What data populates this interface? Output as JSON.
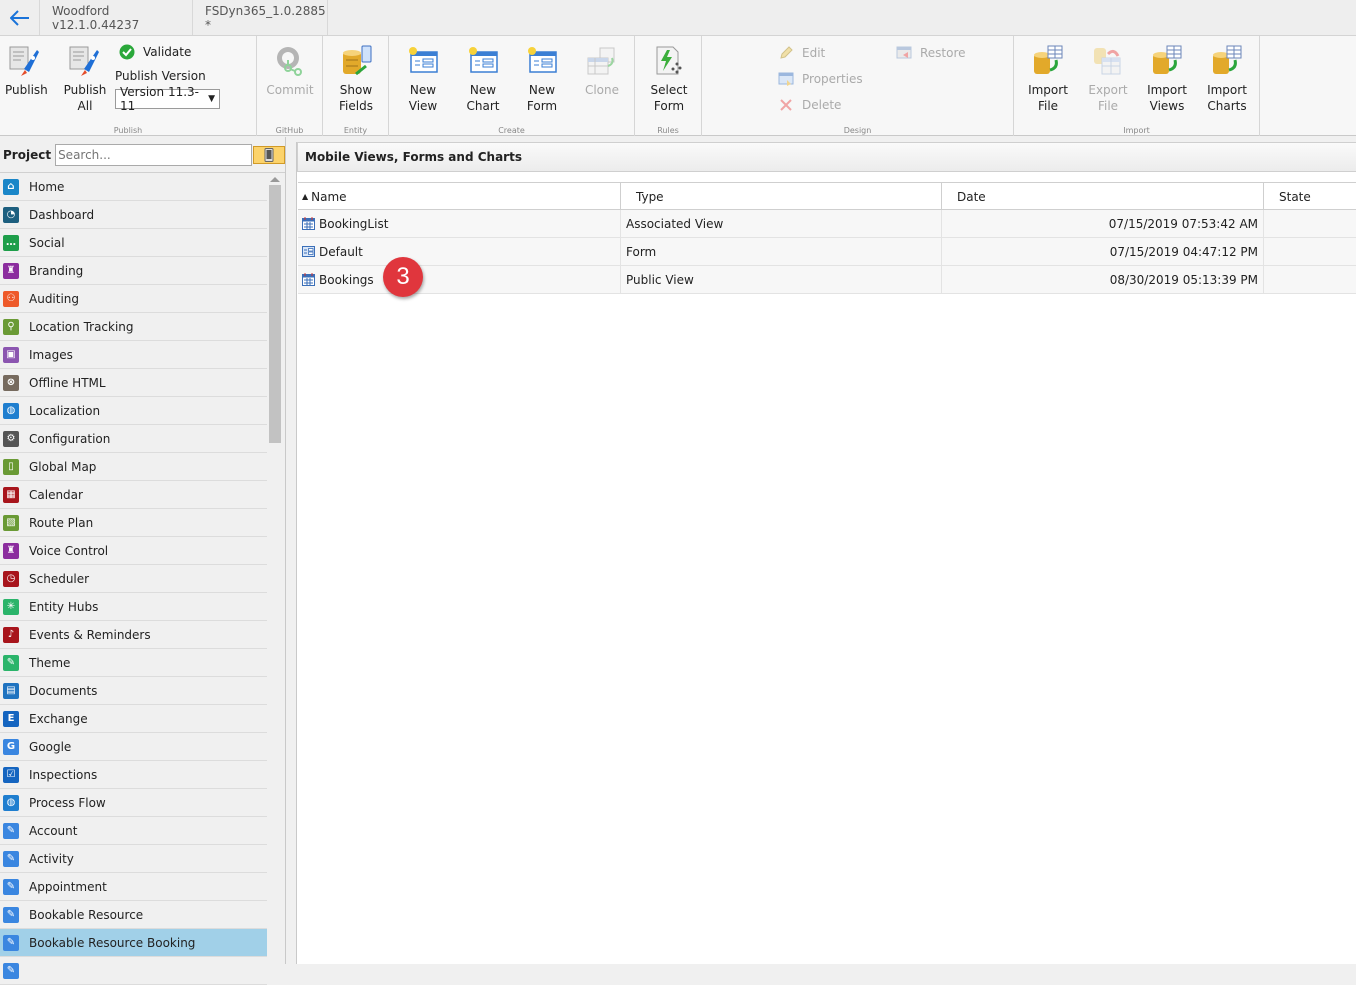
{
  "titlebar": {
    "tabs": [
      "Woodford v12.1.0.44237",
      "FSDyn365_1.0.2885 *"
    ]
  },
  "ribbon": {
    "publish_group": {
      "label": "Publish",
      "publish": "Publish",
      "publish_all": "Publish All",
      "validate": "Validate",
      "publish_version_label": "Publish Version",
      "version_selected": "Version 11.3-11"
    },
    "github_group": {
      "label": "GitHub",
      "commit": "Commit"
    },
    "entity_group": {
      "label": "Entity",
      "show_fields_1": "Show",
      "show_fields_2": "Fields"
    },
    "create_group": {
      "label": "Create",
      "new_view": "New View",
      "new_chart": "New Chart",
      "new_form": "New Form",
      "clone": "Clone"
    },
    "rules_group": {
      "label": "Rules",
      "select_form_1": "Select",
      "select_form_2": "Form"
    },
    "design_group": {
      "label": "Design",
      "edit": "Edit",
      "properties": "Properties",
      "delete": "Delete",
      "restore": "Restore"
    },
    "import_group": {
      "label": "Import",
      "import_file": "Import File",
      "export_file": "Export File",
      "import_views_1": "Import",
      "import_views_2": "Views",
      "import_charts_1": "Import",
      "import_charts_2": "Charts"
    }
  },
  "project": {
    "label": "Project",
    "search_placeholder": "Search...",
    "items": [
      {
        "label": "Home",
        "color": "#1a86c8",
        "glyph": "⌂"
      },
      {
        "label": "Dashboard",
        "color": "#1d5f7f",
        "glyph": "◔"
      },
      {
        "label": "Social",
        "color": "#1e9e4a",
        "glyph": "…"
      },
      {
        "label": "Branding",
        "color": "#8b2d9e",
        "glyph": "♜"
      },
      {
        "label": "Auditing",
        "color": "#ee5a2a",
        "glyph": "⚇"
      },
      {
        "label": "Location Tracking",
        "color": "#6a9a35",
        "glyph": "⚲"
      },
      {
        "label": "Images",
        "color": "#8b55b0",
        "glyph": "▣"
      },
      {
        "label": "Offline HTML",
        "color": "#766a5e",
        "glyph": "⊗"
      },
      {
        "label": "Localization",
        "color": "#1f7ecf",
        "glyph": "◍"
      },
      {
        "label": "Configuration",
        "color": "#555555",
        "glyph": "⚙"
      },
      {
        "label": "Global Map",
        "color": "#6a9a35",
        "glyph": "▯"
      },
      {
        "label": "Calendar",
        "color": "#a8151c",
        "glyph": "▦"
      },
      {
        "label": "Route Plan",
        "color": "#6a9a35",
        "glyph": "▧"
      },
      {
        "label": "Voice Control",
        "color": "#8b2d9e",
        "glyph": "♜"
      },
      {
        "label": "Scheduler",
        "color": "#a8151c",
        "glyph": "◷"
      },
      {
        "label": "Entity Hubs",
        "color": "#2bb46a",
        "glyph": "✳"
      },
      {
        "label": "Events & Reminders",
        "color": "#a8151c",
        "glyph": "♪"
      },
      {
        "label": "Theme",
        "color": "#2bb46a",
        "glyph": "✎"
      },
      {
        "label": "Documents",
        "color": "#1f73c0",
        "glyph": "▤"
      },
      {
        "label": "Exchange",
        "color": "#1565c0",
        "glyph": "E"
      },
      {
        "label": "Google",
        "color": "#3a86e0",
        "glyph": "G"
      },
      {
        "label": "Inspections",
        "color": "#1565c0",
        "glyph": "☑"
      },
      {
        "label": "Process Flow",
        "color": "#1f7ecf",
        "glyph": "◍"
      },
      {
        "label": "Account",
        "color": "#3a86e0",
        "glyph": "✎"
      },
      {
        "label": "Activity",
        "color": "#3a86e0",
        "glyph": "✎"
      },
      {
        "label": "Appointment",
        "color": "#3a86e0",
        "glyph": "✎"
      },
      {
        "label": "Bookable Resource",
        "color": "#3a86e0",
        "glyph": "✎"
      },
      {
        "label": "Bookable Resource Booking",
        "color": "#3a86e0",
        "glyph": "✎",
        "selected": true
      },
      {
        "label": "",
        "color": "#3a86e0",
        "glyph": "✎"
      }
    ]
  },
  "main": {
    "header": "Mobile Views, Forms and Charts",
    "columns": [
      "Name",
      "Type",
      "Date",
      "State"
    ],
    "sort_column": "Name",
    "sort_direction": "ascending",
    "rows": [
      {
        "name": "BookingList",
        "type": "Associated View",
        "date": "07/15/2019 07:53:42 AM",
        "state": "",
        "icon": "view-icon"
      },
      {
        "name": "Default",
        "type": "Form",
        "date": "07/15/2019 04:47:12 PM",
        "state": "",
        "icon": "form-icon"
      },
      {
        "name": "Bookings",
        "type": "Public View",
        "date": "08/30/2019 05:13:39 PM",
        "state": "",
        "icon": "view-icon"
      }
    ],
    "step_badge": "3"
  },
  "colors": {
    "accent": "#1a73d9",
    "selected_row": "#a1d0e8",
    "badge": "#e0363d",
    "device_toggle": "#fcd36b"
  }
}
